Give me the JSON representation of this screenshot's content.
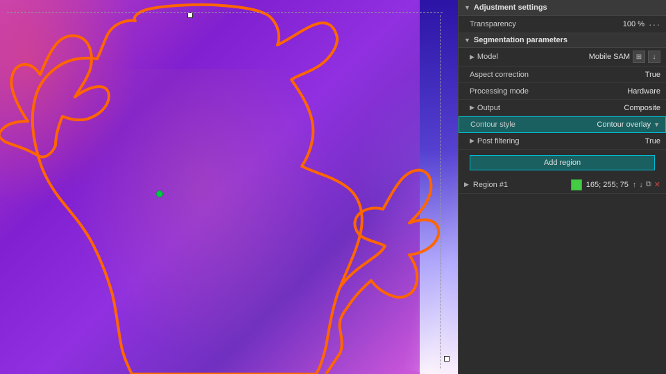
{
  "panel": {
    "title": "Adjustment settings",
    "sections": {
      "adjustment": {
        "header": "Adjustment settings",
        "rows": [
          {
            "label": "Transparency",
            "value": "100 %"
          }
        ]
      },
      "segmentation": {
        "header": "Segmentation parameters",
        "rows": [
          {
            "label": "Model",
            "value": "Mobile SAM",
            "hasIcons": true
          },
          {
            "label": "Aspect correction",
            "value": "True"
          },
          {
            "label": "Processing mode",
            "value": "Hardware"
          },
          {
            "label": "Output",
            "value": "Composite"
          },
          {
            "label": "Contour style",
            "value": "Contour overlay",
            "highlighted": true,
            "hasDropdown": true
          },
          {
            "label": "Post filtering",
            "value": "True"
          }
        ]
      },
      "region": {
        "addButtonLabel": "Add region",
        "regionLabel": "Region #1",
        "regionColor": "#44dd44",
        "regionValues": "165; 255; 75"
      }
    }
  },
  "canvas": {
    "selectionHandles": true
  },
  "icons": {
    "arrow_right": "▶",
    "arrow_down": "▼",
    "dropdown": "▼",
    "dots": "···",
    "up": "↑",
    "down": "↓",
    "copy": "⧉",
    "close": "✕"
  }
}
